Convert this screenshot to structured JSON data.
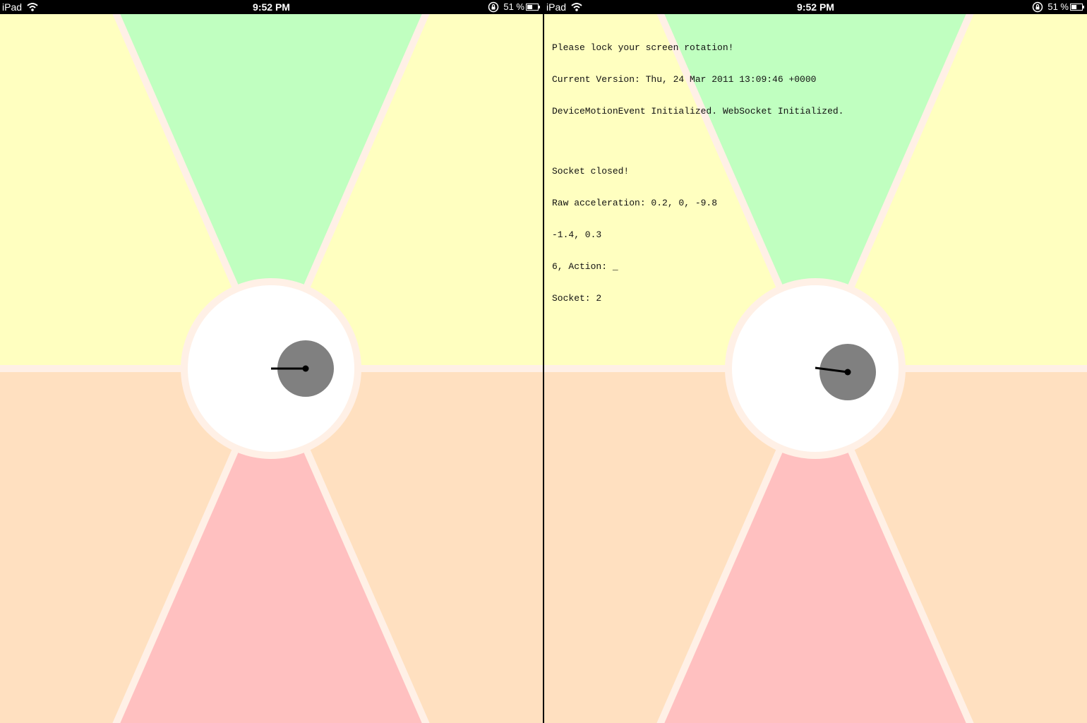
{
  "status_bar": {
    "carrier": "iPad",
    "time": "9:52 PM",
    "battery": "51 %",
    "battery_level": 0.51
  },
  "colors": {
    "top_zone": "#c0ffc0",
    "side_upper_zone": "#ffffc0",
    "side_lower_zone": "#ffe0c0",
    "bottom_zone": "#ffc0c0",
    "divider": "#fff0e6",
    "dial_face": "#ffffff",
    "knob": "#808080",
    "needle": "#000000"
  },
  "screens": [
    {
      "name": "left",
      "console": null
    },
    {
      "name": "right",
      "console": {
        "lines_top": [
          "Please lock your screen rotation!",
          "Current Version: Thu, 24 Mar 2011 13:09:46 +0000",
          "DeviceMotionEvent Initialized. WebSocket Initialized."
        ],
        "lines_bottom": [
          "Socket closed!",
          "Raw acceleration: 0.2, 0, -9.8",
          "-1.4, 0.3",
          "6, Action: _",
          "Socket: 2"
        ]
      }
    }
  ]
}
